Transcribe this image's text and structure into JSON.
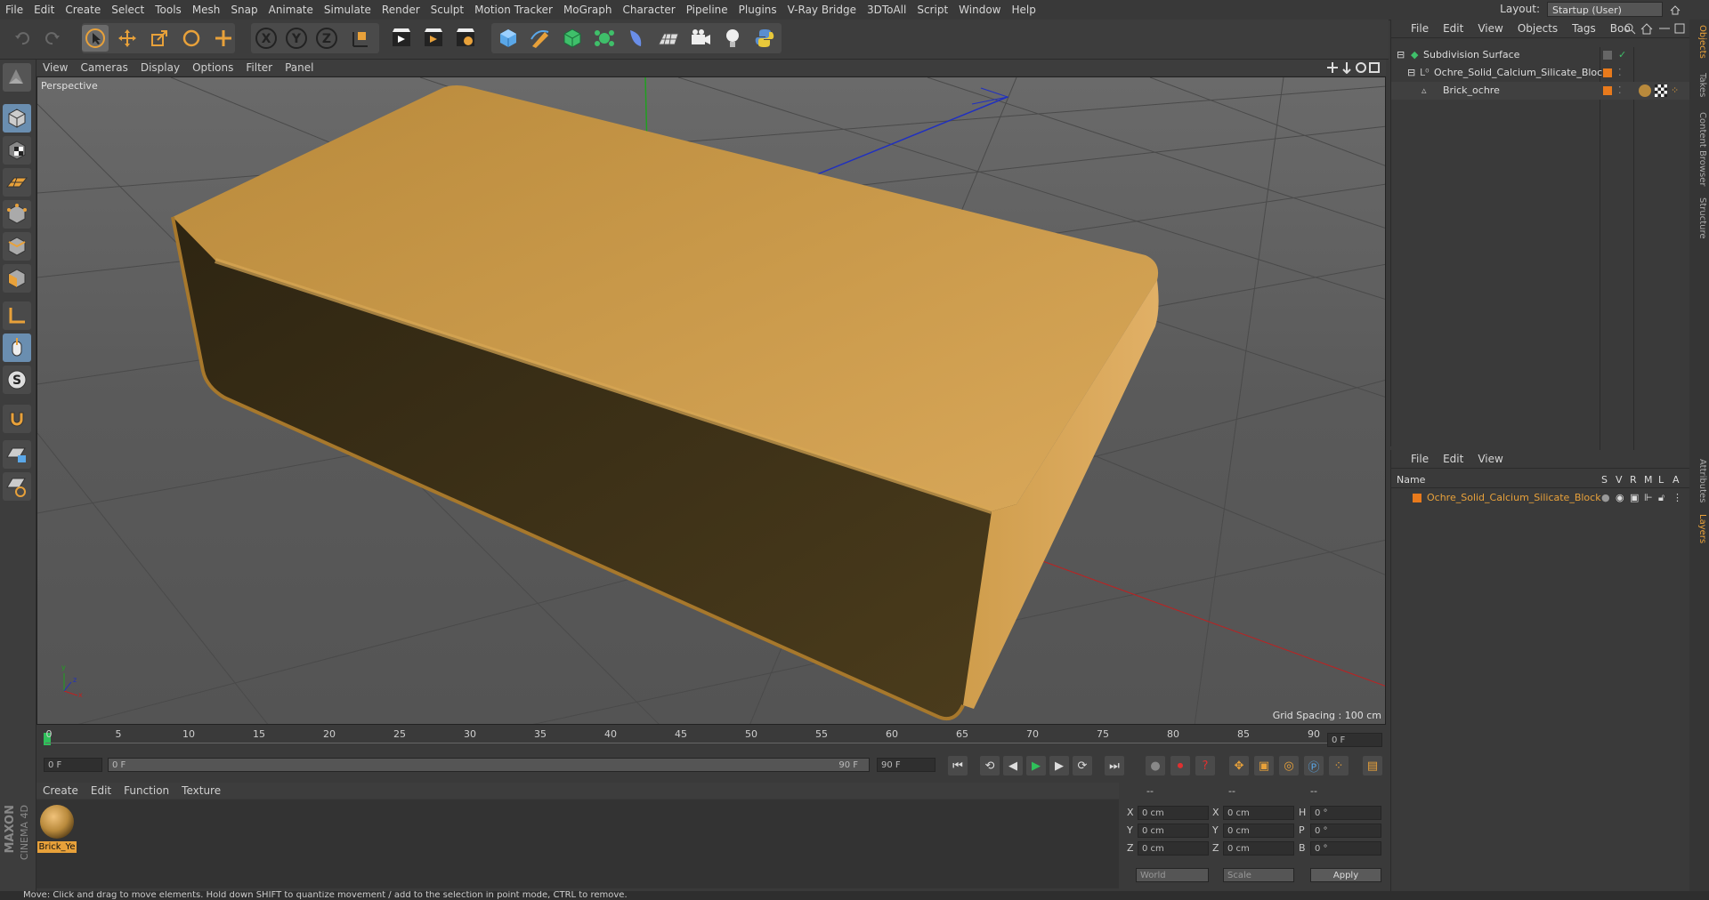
{
  "menu": [
    "File",
    "Edit",
    "Create",
    "Select",
    "Tools",
    "Mesh",
    "Snap",
    "Animate",
    "Simulate",
    "Render",
    "Sculpt",
    "Motion Tracker",
    "MoGraph",
    "Character",
    "Pipeline",
    "Plugins",
    "V-Ray Bridge",
    "3DToAll",
    "Script",
    "Window",
    "Help"
  ],
  "layout": {
    "label": "Layout:",
    "value": "Startup (User)"
  },
  "viewport": {
    "menu": [
      "View",
      "Cameras",
      "Display",
      "Options",
      "Filter",
      "Panel"
    ],
    "label": "Perspective",
    "grid_spacing": "Grid Spacing : 100 cm"
  },
  "timeline": {
    "ticks": [
      "0",
      "5",
      "10",
      "15",
      "20",
      "25",
      "30",
      "35",
      "40",
      "45",
      "50",
      "55",
      "60",
      "65",
      "70",
      "75",
      "80",
      "85",
      "90"
    ],
    "current_frame": "0 F",
    "start": "0 F",
    "slider_left": "0 F",
    "slider_right": "90 F",
    "end": "90 F"
  },
  "material_manager": {
    "menu": [
      "Create",
      "Edit",
      "Function",
      "Texture"
    ],
    "materials": [
      {
        "name": "Brick_Ye"
      }
    ]
  },
  "coordinates": {
    "header": [
      "--",
      "--",
      "--"
    ],
    "rows": [
      {
        "a": "X",
        "av": "0 cm",
        "b": "X",
        "bv": "0 cm",
        "c": "H",
        "cv": "0 °"
      },
      {
        "a": "Y",
        "av": "0 cm",
        "b": "Y",
        "bv": "0 cm",
        "c": "P",
        "cv": "0 °"
      },
      {
        "a": "Z",
        "av": "0 cm",
        "b": "Z",
        "bv": "0 cm",
        "c": "B",
        "cv": "0 °"
      }
    ],
    "mode": "World",
    "type": "Scale",
    "apply": "Apply"
  },
  "object_manager": {
    "menu": [
      "File",
      "Edit",
      "View",
      "Objects",
      "Tags",
      "Boo"
    ],
    "objects": [
      {
        "name": "Subdivision Surface",
        "indent": 0
      },
      {
        "name": "Ochre_Solid_Calcium_Silicate_Block",
        "indent": 1
      },
      {
        "name": "Brick_ochre",
        "indent": 2
      }
    ]
  },
  "layer_manager": {
    "menu": [
      "File",
      "Edit",
      "View"
    ],
    "columns": [
      "Name",
      "S",
      "V",
      "R",
      "M",
      "L",
      "A"
    ],
    "layers": [
      {
        "name": "Ochre_Solid_Calcium_Silicate_Block",
        "color": "#e87a1c"
      }
    ]
  },
  "side_tabs": [
    "Objects",
    "Takes",
    "Content Browser",
    "Structure",
    "Attributes",
    "Layers"
  ],
  "status": "Move: Click and drag to move elements. Hold down SHIFT to quantize movement / add to the selection in point mode, CTRL to remove.",
  "brand": {
    "line1": "MAXON",
    "line2": "CINEMA 4D"
  },
  "colors": {
    "accent": "#e8a13a",
    "brick_top": "#c8963c",
    "brick_side": "#4a3a1e",
    "axis_x": "#c02020",
    "axis_y": "#20a020",
    "axis_z": "#2030c0"
  }
}
